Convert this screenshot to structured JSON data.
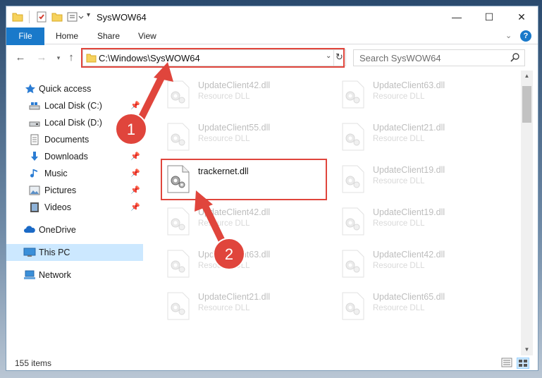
{
  "window": {
    "title": "SysWOW64",
    "controls": {
      "minimize": "—",
      "maximize": "☐",
      "close": "✕"
    }
  },
  "ribbon": {
    "tabs": [
      "File",
      "Home",
      "Share",
      "View"
    ],
    "help": "?"
  },
  "address": {
    "path": "C:\\Windows\\SysWOW64",
    "search_placeholder": "Search SysWOW64"
  },
  "nav": {
    "items": [
      {
        "label": "Quick access",
        "icon": "star-icon",
        "pinned": false
      },
      {
        "label": "Local Disk (C:)",
        "icon": "drive-icon",
        "pinned": true
      },
      {
        "label": "Local Disk (D:)",
        "icon": "drive-icon",
        "pinned": true
      },
      {
        "label": "Documents",
        "icon": "documents-icon",
        "pinned": true
      },
      {
        "label": "Downloads",
        "icon": "download-icon",
        "pinned": true
      },
      {
        "label": "Music",
        "icon": "music-icon",
        "pinned": true
      },
      {
        "label": "Pictures",
        "icon": "pictures-icon",
        "pinned": true
      },
      {
        "label": "Videos",
        "icon": "videos-icon",
        "pinned": true
      },
      {
        "label": "OneDrive",
        "icon": "cloud-icon",
        "pinned": false
      },
      {
        "label": "This PC",
        "icon": "computer-icon",
        "pinned": false,
        "selected": true
      },
      {
        "label": "Network",
        "icon": "network-icon",
        "pinned": false
      }
    ]
  },
  "files": {
    "left_column": [
      {
        "name": "UpdateClient42.dll",
        "type": "Resource DLL",
        "faded": true
      },
      {
        "name": "UpdateClient55.dll",
        "type": "Resource DLL",
        "faded": true
      },
      {
        "name": "trackernet.dll",
        "type": "",
        "faded": false,
        "highlighted": true
      },
      {
        "name": "UpdateClient42.dll",
        "type": "Resource DLL",
        "faded": true
      },
      {
        "name": "UpdateClient63.dll",
        "type": "Resource DLL",
        "faded": true
      },
      {
        "name": "UpdateClient21.dll",
        "type": "Resource DLL",
        "faded": true
      }
    ],
    "right_column": [
      {
        "name": "UpdateClient63.dll",
        "type": "Resource DLL",
        "faded": true
      },
      {
        "name": "UpdateClient21.dll",
        "type": "Resource DLL",
        "faded": true
      },
      {
        "name": "UpdateClient19.dll",
        "type": "Resource DLL",
        "faded": true
      },
      {
        "name": "UpdateClient19.dll",
        "type": "Resource DLL",
        "faded": true
      },
      {
        "name": "UpdateClient42.dll",
        "type": "Resource DLL",
        "faded": true
      },
      {
        "name": "UpdateClient65.dll",
        "type": "Resource DLL",
        "faded": true
      }
    ]
  },
  "status": {
    "item_count": "155 items"
  },
  "annotations": {
    "step1": "1",
    "step2": "2",
    "color": "#e0453c"
  },
  "colors": {
    "accent": "#1979ca",
    "selected_bg": "#cce8ff"
  }
}
